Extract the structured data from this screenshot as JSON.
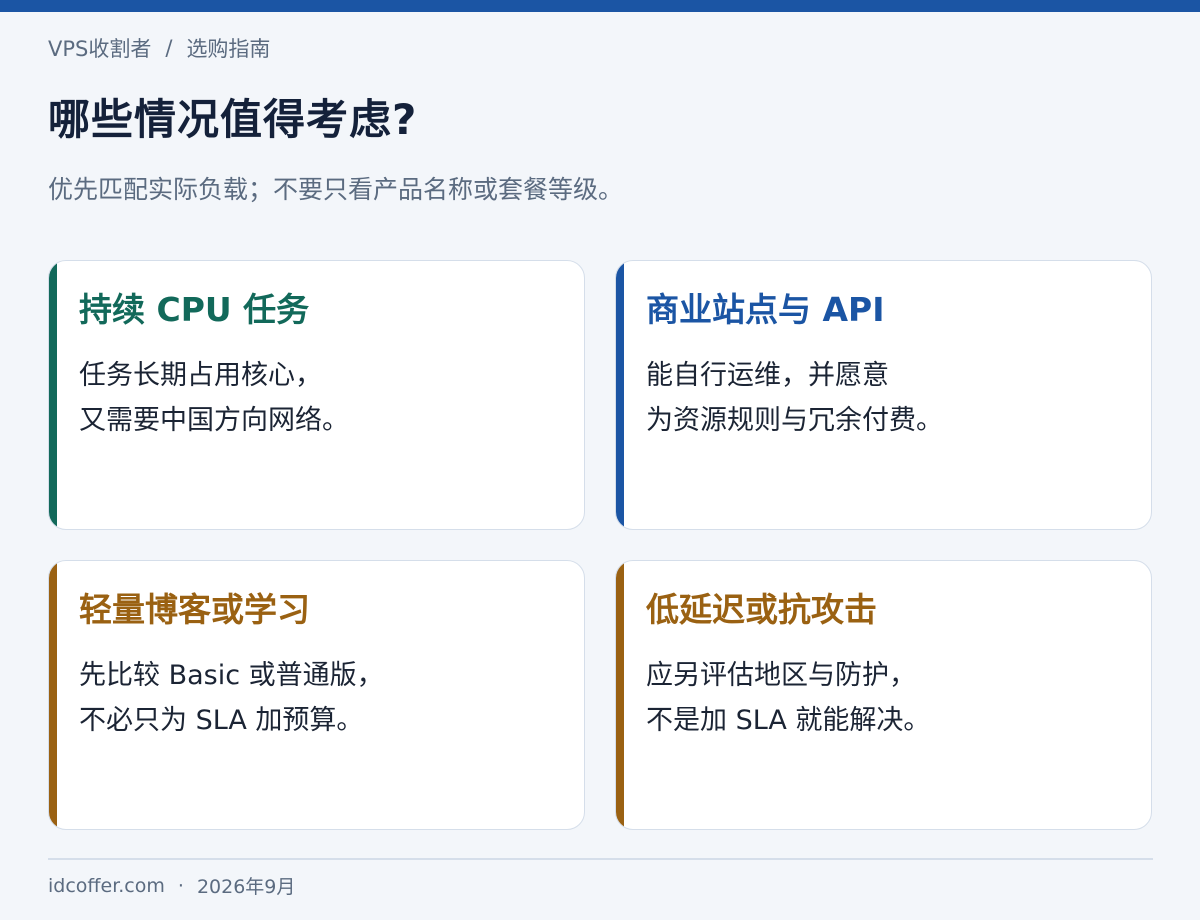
{
  "breadcrumb": {
    "site": "VPS收割者",
    "separator": "/",
    "page": "选购指南"
  },
  "header": {
    "title": "哪些情况值得考虑?",
    "subtitle": "优先匹配实际负载；不要只看产品名称或套餐等级。"
  },
  "cards": [
    {
      "title": "持续 CPU 任务",
      "lines": [
        "任务长期占用核心，",
        "又需要中国方向网络。"
      ],
      "accent": "#12695a"
    },
    {
      "title": "商业站点与 API",
      "lines": [
        "能自行运维，并愿意",
        "为资源规则与冗余付费。"
      ],
      "accent": "#1b55a4"
    },
    {
      "title": "轻量博客或学习",
      "lines": [
        "先比较 Basic 或普通版，",
        "不必只为 SLA 加预算。"
      ],
      "accent": "#9a6112"
    },
    {
      "title": "低延迟或抗攻击",
      "lines": [
        "应另评估地区与防护，",
        "不是加 SLA 就能解决。"
      ],
      "accent": "#9a6112"
    }
  ],
  "footer": {
    "domain": "idcoffer.com",
    "separator": "·",
    "date": "2026年9月"
  }
}
